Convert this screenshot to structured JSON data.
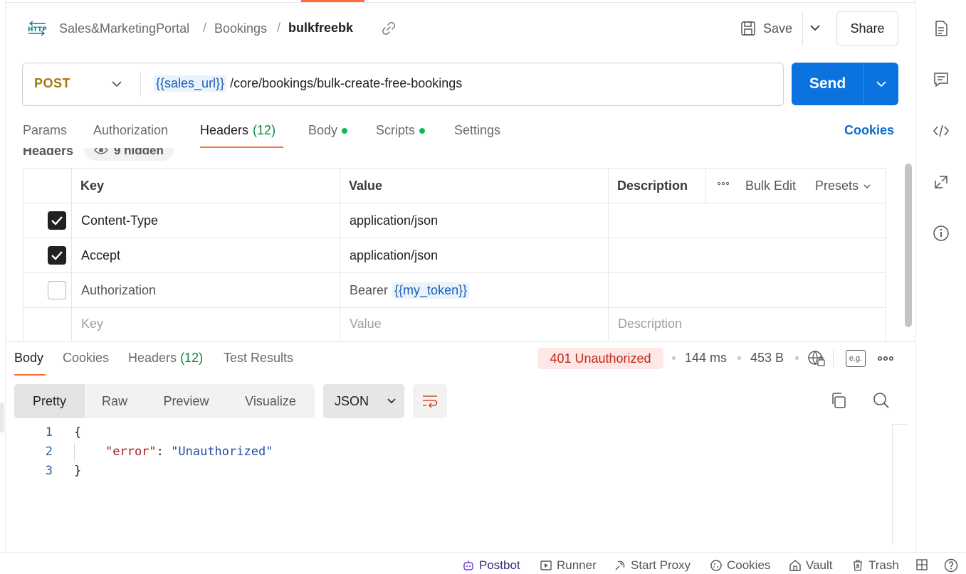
{
  "breadcrumb": {
    "collection": "Sales&MarketingPortal",
    "folder": "Bookings",
    "request": "bulkfreebk",
    "separator": "/"
  },
  "http_badge": "HTTP",
  "header_actions": {
    "save": "Save",
    "share": "Share"
  },
  "url_bar": {
    "method": "POST",
    "variable": "{{sales_url}}",
    "path": " /core/bookings/bulk-create-free-bookings",
    "send": "Send"
  },
  "request_tabs": {
    "params": "Params",
    "authorization": "Authorization",
    "headers": "Headers",
    "headers_count": "(12)",
    "body": "Body",
    "scripts": "Scripts",
    "settings": "Settings",
    "cookies": "Cookies"
  },
  "hidden_headers": {
    "label": "Headers",
    "hidden": "9 hidden"
  },
  "headers_table": {
    "columns": {
      "key": "Key",
      "value": "Value",
      "description": "Description",
      "bulk_edit": "Bulk Edit",
      "presets": "Presets"
    },
    "rows": [
      {
        "checked": true,
        "key": "Content-Type",
        "value": "application/json"
      },
      {
        "checked": true,
        "key": "Accept",
        "value": "application/json"
      },
      {
        "checked": false,
        "key": "Authorization",
        "value_prefix": "Bearer",
        "value_var": "{{my_token}}"
      }
    ],
    "placeholders": {
      "key": "Key",
      "value": "Value",
      "description": "Description"
    }
  },
  "response_tabs": {
    "body": "Body",
    "cookies": "Cookies",
    "headers": "Headers",
    "headers_count": "(12)",
    "test_results": "Test Results"
  },
  "response_meta": {
    "status": "401 Unauthorized",
    "time": "144 ms",
    "size": "453 B",
    "example_badge": "e.g."
  },
  "view_modes": {
    "pretty": "Pretty",
    "raw": "Raw",
    "preview": "Preview",
    "visualize": "Visualize",
    "format": "JSON"
  },
  "response_body": {
    "line_numbers": [
      "1",
      "2",
      "3"
    ],
    "open_brace": "{",
    "key": "\"error\"",
    "colon": ": ",
    "value": "\"Unauthorized\"",
    "close_brace": "}"
  },
  "footer": {
    "postbot": "Postbot",
    "runner": "Runner",
    "start_proxy": "Start Proxy",
    "cookies": "Cookies",
    "vault": "Vault",
    "trash": "Trash"
  },
  "colors": {
    "accent": "#ff6c37",
    "send": "#0b73e0",
    "post": "#a5780d",
    "status_error": "#c1281a",
    "success_dot": "#0cbb52"
  }
}
